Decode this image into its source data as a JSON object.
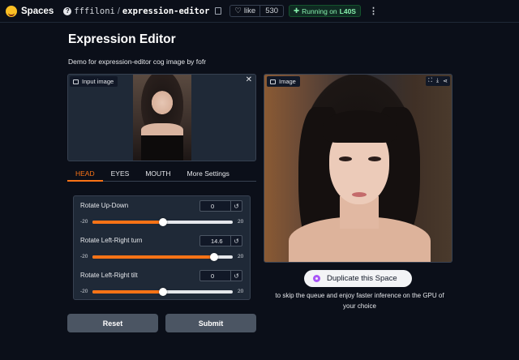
{
  "topbar": {
    "brand": "Spaces",
    "owner": "fffiloni",
    "slash": "/",
    "repo": "expression-editor",
    "like_label": "like",
    "like_count": "530",
    "status_prefix": "Running on",
    "status_hw": "L40S"
  },
  "page": {
    "title": "Expression Editor",
    "subtitle": "Demo for expression-editor cog image by fofr"
  },
  "input_image": {
    "label": "Input image"
  },
  "tabs": [
    {
      "label": "HEAD",
      "active": true
    },
    {
      "label": "EYES",
      "active": false
    },
    {
      "label": "MOUTH",
      "active": false
    },
    {
      "label": "More Settings",
      "active": false
    }
  ],
  "sliders": [
    {
      "label": "Rotate Up-Down",
      "value": "0",
      "min": "-20",
      "max": "20",
      "fraction": 0.5
    },
    {
      "label": "Rotate Left-Right turn",
      "value": "14.6",
      "min": "-20",
      "max": "20",
      "fraction": 0.865
    },
    {
      "label": "Rotate Left-Right tilt",
      "value": "0",
      "min": "-20",
      "max": "20",
      "fraction": 0.5
    }
  ],
  "buttons": {
    "reset": "Reset",
    "submit": "Submit"
  },
  "output_image": {
    "label": "Image"
  },
  "duplicate": {
    "label": "Duplicate this Space",
    "note": "to skip the queue and enjoy faster inference on the GPU of your choice"
  },
  "colors": {
    "accent": "#f97316",
    "background": "#0b0f19",
    "panel": "#1f2937"
  }
}
